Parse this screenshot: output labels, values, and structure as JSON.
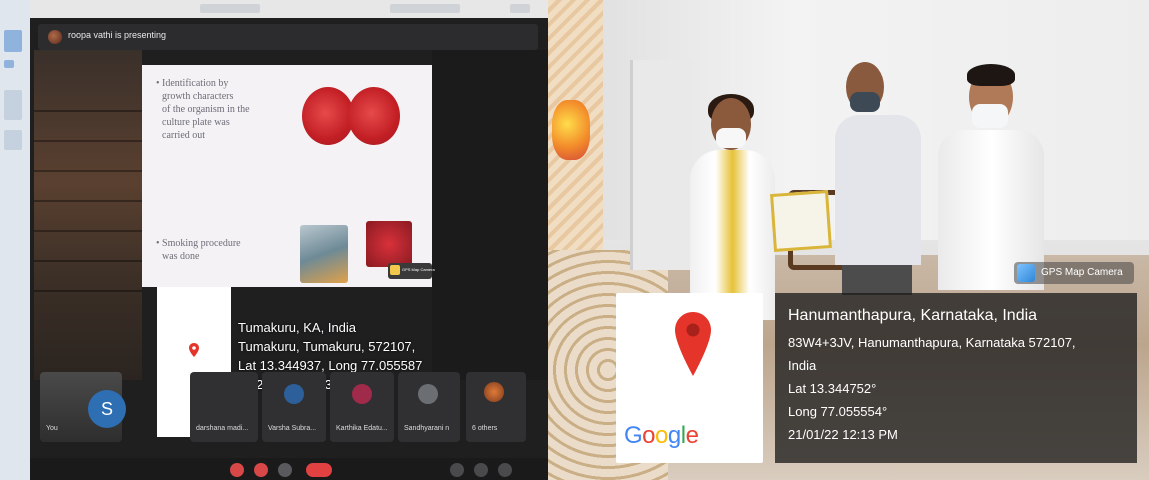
{
  "left_screenshot": {
    "presenter_text": "roopa vathi is presenting",
    "slide": {
      "bullet1_lines": [
        "• Identification by",
        "growth characters",
        "of the organism in the",
        "culture plate was",
        "carried out"
      ],
      "bullet2_lines": [
        "• Smoking procedure",
        "was done"
      ],
      "thumb_label": "GPS Map Camera"
    },
    "location_stamp": {
      "line1": "Tumakuru, KA, India",
      "line2": "Tumakuru, Tumakuru, 572107,",
      "line3": "Lat 13.344937, Long 77.055587",
      "line4": "01/21/2022 10:37 AM"
    },
    "participants": [
      {
        "name": "You",
        "initial": "S"
      },
      {
        "name": "darshana madi..."
      },
      {
        "name": "Varsha Subra..."
      },
      {
        "name": "Karthika Edatu..."
      },
      {
        "name": "Sandhyarani n"
      },
      {
        "name": "6 others"
      }
    ],
    "icons": [
      "presenter-avatar-icon",
      "map-pin-icon",
      "mic-icon",
      "camera-icon",
      "end-call-icon"
    ]
  },
  "right_photo": {
    "gps_badge": "GPS Map Camera",
    "google_logo": [
      "G",
      "o",
      "o",
      "g",
      "l",
      "e"
    ],
    "google_colors": [
      "#4285F4",
      "#EA4335",
      "#FBBC05",
      "#4285F4",
      "#34A853",
      "#EA4335"
    ],
    "location": {
      "title": "Hanumanthapura, Karnataka, India",
      "address_line1": "83W4+3JV, Hanumanthapura, Karnataka 572107,",
      "address_line2": "India",
      "lat": "Lat 13.344752°",
      "long": "Long 77.055554°",
      "datetime": "21/01/22 12:13 PM"
    },
    "pin_color": "#e5342a"
  }
}
